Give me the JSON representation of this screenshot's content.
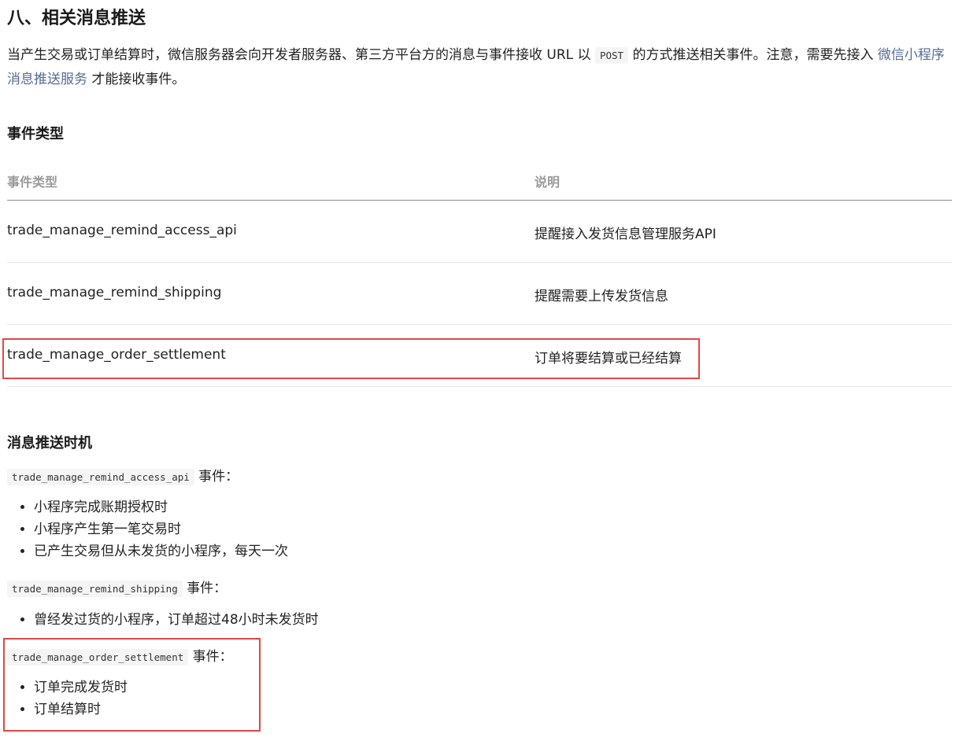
{
  "section": {
    "title": "八、相关消息推送",
    "intro_before_code": "当产生交易或订单结算时，微信服务器会向开发者服务器、第三方平台方的消息与事件接收 URL 以 ",
    "intro_code": "POST",
    "intro_after_code": " 的方式推送相关事件。注意，需要先接入 ",
    "intro_link": "微信小程序消息推送服务",
    "intro_end": " 才能接收事件。"
  },
  "events": {
    "heading": "事件类型",
    "columns": [
      "事件类型",
      "说明"
    ],
    "rows": [
      {
        "type": "trade_manage_remind_access_api",
        "desc": "提醒接入发货信息管理服务API"
      },
      {
        "type": "trade_manage_remind_shipping",
        "desc": "提醒需要上传发货信息"
      },
      {
        "type": "trade_manage_order_settlement",
        "desc": "订单将要结算或已经结算"
      }
    ]
  },
  "timing": {
    "heading": "消息推送时机",
    "suffix": " 事件：",
    "groups": [
      {
        "code": "trade_manage_remind_access_api",
        "items": [
          "小程序完成账期授权时",
          "小程序产生第一笔交易时",
          "已产生交易但从未发货的小程序，每天一次"
        ]
      },
      {
        "code": "trade_manage_remind_shipping",
        "items": [
          "曾经发过货的小程序，订单超过48小时未发货时"
        ]
      },
      {
        "code": "trade_manage_order_settlement",
        "items": [
          "订单完成发货时",
          "订单结算时"
        ]
      }
    ]
  },
  "colors": {
    "highlight": "#e0474c",
    "link": "#576b95"
  }
}
